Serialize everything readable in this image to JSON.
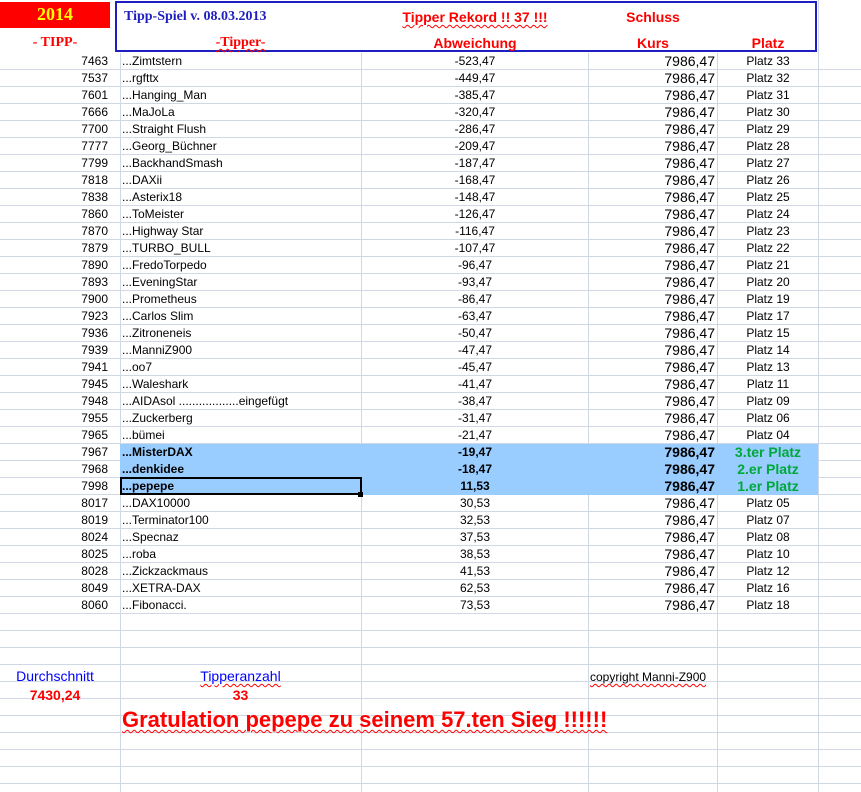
{
  "header": {
    "year": "2014",
    "subtitle": "- TIPP-",
    "title": "Tipp-Spiel v. 08.03.2013",
    "tipper_label": "-Tipper-",
    "record": "Tipper Rekord !!  37  !!!",
    "deviation_label": "Abweichung",
    "close_label": "Schluss",
    "rate_label": "Kurs",
    "rank_label": "Platz"
  },
  "rows": [
    {
      "tipp": "7463",
      "name": "...Zimtstern",
      "dev": "-523,47",
      "kurs": "7986,47",
      "platz": "Platz 33"
    },
    {
      "tipp": "7537",
      "name": "...rgfttx",
      "dev": "-449,47",
      "kurs": "7986,47",
      "platz": "Platz 32"
    },
    {
      "tipp": "7601",
      "name": "...Hanging_Man",
      "dev": "-385,47",
      "kurs": "7986,47",
      "platz": "Platz 31"
    },
    {
      "tipp": "7666",
      "name": "...MaJoLa",
      "dev": "-320,47",
      "kurs": "7986,47",
      "platz": "Platz 30"
    },
    {
      "tipp": "7700",
      "name": "...Straight Flush",
      "dev": "-286,47",
      "kurs": "7986,47",
      "platz": "Platz 29"
    },
    {
      "tipp": "7777",
      "name": "...Georg_Büchner",
      "dev": "-209,47",
      "kurs": "7986,47",
      "platz": "Platz 28"
    },
    {
      "tipp": "7799",
      "name": "...BackhandSmash",
      "dev": "-187,47",
      "kurs": "7986,47",
      "platz": "Platz 27"
    },
    {
      "tipp": "7818",
      "name": "...DAXii",
      "dev": "-168,47",
      "kurs": "7986,47",
      "platz": "Platz 26"
    },
    {
      "tipp": "7838",
      "name": "...Asterix18",
      "dev": "-148,47",
      "kurs": "7986,47",
      "platz": "Platz 25"
    },
    {
      "tipp": "7860",
      "name": "...ToMeister",
      "dev": "-126,47",
      "kurs": "7986,47",
      "platz": "Platz 24"
    },
    {
      "tipp": "7870",
      "name": "...Highway Star",
      "dev": "-116,47",
      "kurs": "7986,47",
      "platz": "Platz 23"
    },
    {
      "tipp": "7879",
      "name": "...TURBO_BULL",
      "dev": "-107,47",
      "kurs": "7986,47",
      "platz": "Platz 22"
    },
    {
      "tipp": "7890",
      "name": "...FredoTorpedo",
      "dev": "-96,47",
      "kurs": "7986,47",
      "platz": "Platz 21"
    },
    {
      "tipp": "7893",
      "name": "...EveningStar",
      "dev": "-93,47",
      "kurs": "7986,47",
      "platz": "Platz 20"
    },
    {
      "tipp": "7900",
      "name": "...Prometheus",
      "dev": "-86,47",
      "kurs": "7986,47",
      "platz": "Platz 19"
    },
    {
      "tipp": "7923",
      "name": "...Carlos Slim",
      "dev": "-63,47",
      "kurs": "7986,47",
      "platz": "Platz 17"
    },
    {
      "tipp": "7936",
      "name": "...Zitroneneis",
      "dev": "-50,47",
      "kurs": "7986,47",
      "platz": "Platz 15"
    },
    {
      "tipp": "7939",
      "name": "...ManniZ900",
      "dev": "-47,47",
      "kurs": "7986,47",
      "platz": "Platz 14"
    },
    {
      "tipp": "7941",
      "name": "...oo7",
      "dev": "-45,47",
      "kurs": "7986,47",
      "platz": "Platz 13"
    },
    {
      "tipp": "7945",
      "name": "...Waleshark",
      "dev": "-41,47",
      "kurs": "7986,47",
      "platz": "Platz 11"
    },
    {
      "tipp": "7948",
      "name": "...AIDAsol ..................eingefügt",
      "dev": "-38,47",
      "kurs": "7986,47",
      "platz": "Platz 09"
    },
    {
      "tipp": "7955",
      "name": "...Zuckerberg",
      "dev": "-31,47",
      "kurs": "7986,47",
      "platz": "Platz 06"
    },
    {
      "tipp": "7965",
      "name": "...bümei",
      "dev": "-21,47",
      "kurs": "7986,47",
      "platz": "Platz 04"
    },
    {
      "tipp": "7967",
      "name": "...MisterDAX",
      "dev": "-19,47",
      "kurs": "7986,47",
      "platz": "3.ter Platz",
      "winner": true
    },
    {
      "tipp": "7968",
      "name": "...denkidee",
      "dev": "-18,47",
      "kurs": "7986,47",
      "platz": "2.er Platz",
      "winner": true
    },
    {
      "tipp": "7998",
      "name": "...pepepe",
      "dev": "11,53",
      "kurs": "7986,47",
      "platz": "1.er Platz",
      "winner": true,
      "selected": true
    },
    {
      "tipp": "8017",
      "name": "...DAX10000",
      "dev": "30,53",
      "kurs": "7986,47",
      "platz": "Platz 05"
    },
    {
      "tipp": "8019",
      "name": "...Terminator100",
      "dev": "32,53",
      "kurs": "7986,47",
      "platz": "Platz 07"
    },
    {
      "tipp": "8024",
      "name": "...Specnaz",
      "dev": "37,53",
      "kurs": "7986,47",
      "platz": "Platz 08"
    },
    {
      "tipp": "8025",
      "name": "...roba",
      "dev": "38,53",
      "kurs": "7986,47",
      "platz": "Platz 10"
    },
    {
      "tipp": "8028",
      "name": "...Zickzackmaus",
      "dev": "41,53",
      "kurs": "7986,47",
      "platz": "Platz 12"
    },
    {
      "tipp": "8049",
      "name": "...XETRA-DAX",
      "dev": "62,53",
      "kurs": "7986,47",
      "platz": "Platz 16"
    },
    {
      "tipp": "8060",
      "name": "...Fibonacci.",
      "dev": "73,53",
      "kurs": "7986,47",
      "platz": "Platz 18"
    }
  ],
  "footer": {
    "avg_label": "Durchschnitt",
    "avg_value": "7430,24",
    "count_label": "Tipperanzahl",
    "count_value": "33",
    "copyright": "copyright Manni-Z900",
    "congrats": "Gratulation pepepe  zu seinem 57.ten Sieg !!!!!!"
  },
  "colors": {
    "header_border": "#1f1fbf",
    "year_bg": "#ff0000",
    "year_text": "#ffff00",
    "highlight": "#99ccff",
    "winner_text": "#00a83a",
    "red_text": "#ff0000",
    "blue_text": "#0000ff",
    "grid": "#d0d7e5"
  }
}
